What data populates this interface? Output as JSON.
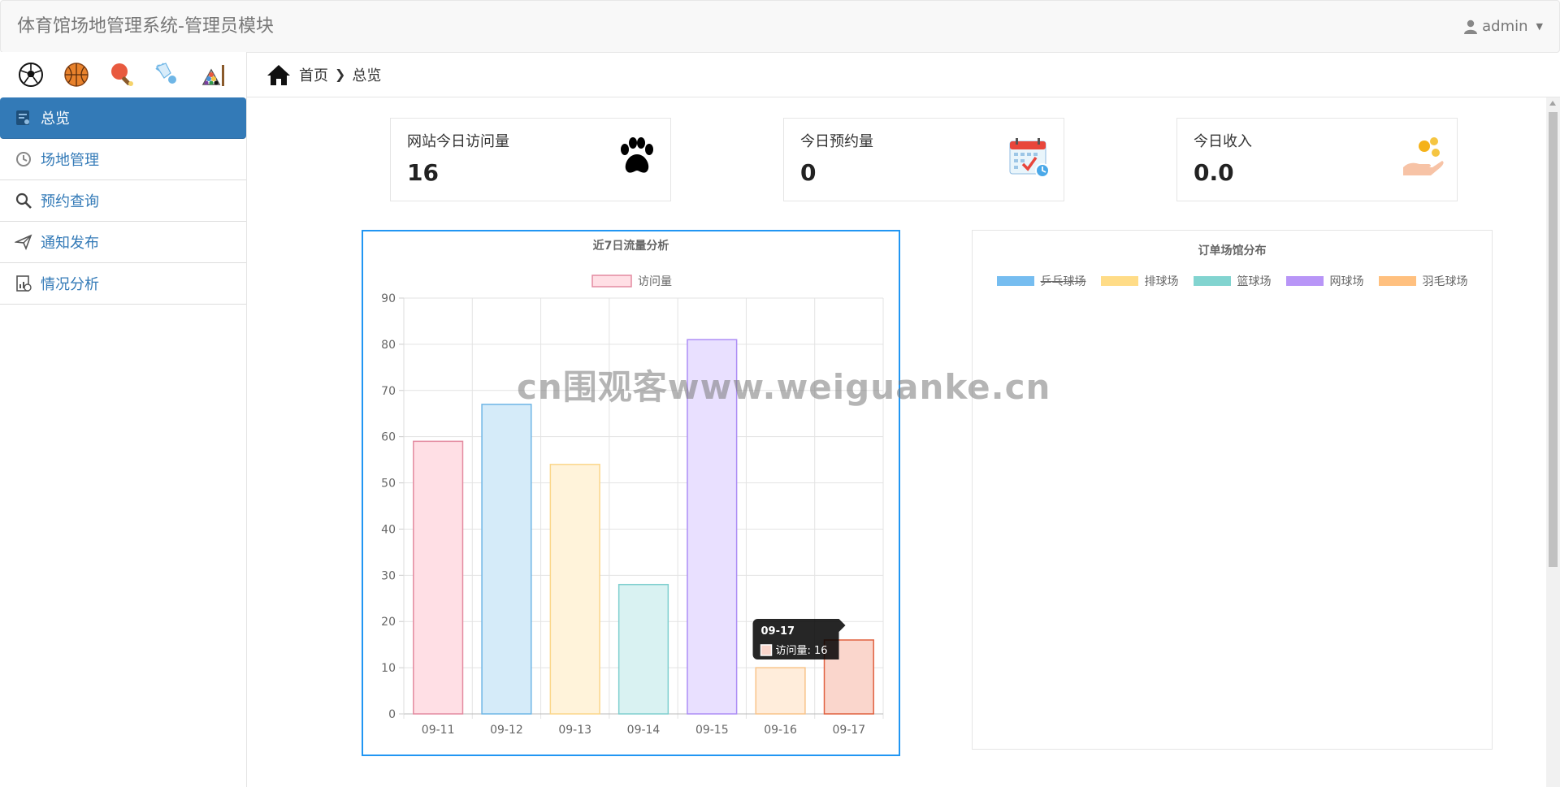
{
  "header": {
    "title": "体育馆场地管理系统-管理员模块",
    "user": "admin"
  },
  "sidebar": {
    "sport_icons": [
      "soccer-icon",
      "basketball-icon",
      "table-tennis-icon",
      "badminton-icon",
      "billiards-icon"
    ],
    "items": [
      {
        "label": "总览",
        "icon": "dashboard-icon",
        "active": true
      },
      {
        "label": "场地管理",
        "icon": "refresh-icon",
        "active": false
      },
      {
        "label": "预约查询",
        "icon": "search-icon",
        "active": false
      },
      {
        "label": "通知发布",
        "icon": "send-icon",
        "active": false
      },
      {
        "label": "情况分析",
        "icon": "report-icon",
        "active": false
      }
    ]
  },
  "breadcrumb": {
    "home": "首页",
    "current": "总览"
  },
  "stats": [
    {
      "label": "网站今日访问量",
      "value": "16",
      "icon": "paw-icon"
    },
    {
      "label": "今日预约量",
      "value": "0",
      "icon": "calendar-icon"
    },
    {
      "label": "今日收入",
      "value": "0.0",
      "icon": "coins-hand-icon"
    }
  ],
  "watermark": "cn围观客www.weiguanke.cn",
  "chart_data": [
    {
      "type": "bar",
      "title": "近7日流量分析",
      "categories": [
        "09-11",
        "09-12",
        "09-13",
        "09-14",
        "09-15",
        "09-16",
        "09-17"
      ],
      "series": [
        {
          "name": "访问量",
          "values": [
            59,
            67,
            54,
            28,
            81,
            10,
            16
          ]
        }
      ],
      "ylim": [
        0,
        90
      ],
      "yticks": [
        0,
        10,
        20,
        30,
        40,
        50,
        60,
        70,
        80,
        90
      ],
      "grid": true,
      "legend_position": "top",
      "fill_colors": [
        "#ffdfe5",
        "#d5ebf9",
        "#fff3da",
        "#d9f2f2",
        "#e9e0ff",
        "#ffeddb",
        "#fad6cc"
      ],
      "border_colors": [
        "#e38aa0",
        "#6fb6e6",
        "#fbd68a",
        "#7fcfcf",
        "#ad8ef5",
        "#f8c48a",
        "#e0603f"
      ],
      "tooltip": {
        "title": "09-17",
        "label": "访问量: 16"
      }
    },
    {
      "type": "pie",
      "title": "订单场馆分布",
      "categories": [
        "乒乓球场",
        "排球场",
        "篮球场",
        "网球场",
        "羽毛球场"
      ],
      "values": [],
      "legend_position": "top",
      "colors": [
        "#76bdf0",
        "#ffdc87",
        "#82d4d0",
        "#b895f7",
        "#ffc07f"
      ],
      "hidden": [
        "乒乓球场"
      ]
    }
  ]
}
